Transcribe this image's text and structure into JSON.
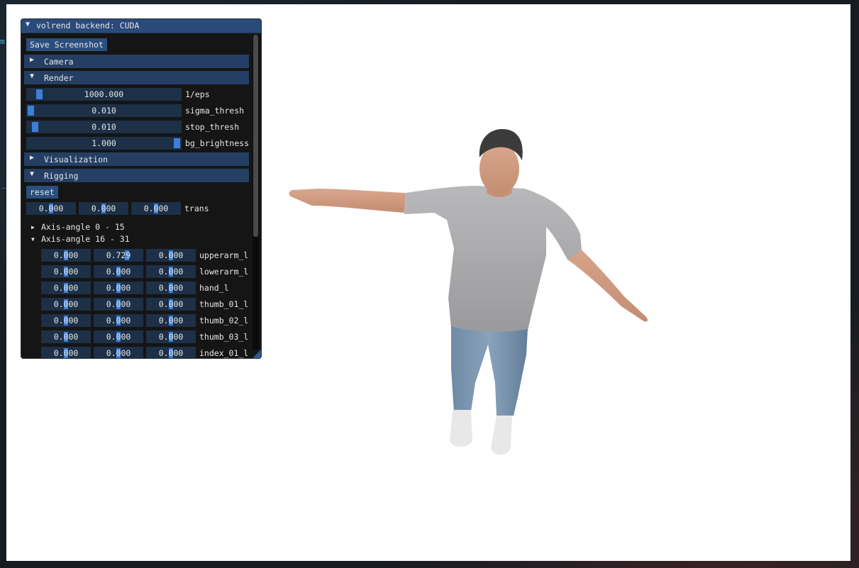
{
  "window": {
    "title": "volrend backend: CUDA",
    "save_screenshot": "Save Screenshot"
  },
  "sections": {
    "camera": "Camera",
    "render": "Render",
    "visualization": "Visualization",
    "rigging": "Rigging"
  },
  "render_params": [
    {
      "label": "1/eps",
      "value": "1000.000",
      "level": 0.06
    },
    {
      "label": "sigma_thresh",
      "value": "0.010",
      "level": 0.0
    },
    {
      "label": "stop_thresh",
      "value": "0.010",
      "level": 0.03
    },
    {
      "label": "bg_brightness",
      "value": "1.000",
      "level": 1.0
    }
  ],
  "rigging": {
    "reset": "reset",
    "trans": {
      "label": "trans",
      "values": [
        "0.000",
        "0.000",
        "0.000"
      ]
    },
    "group_collapsed": "Axis-angle 0 - 15",
    "group_expanded": "Axis-angle 16 - 31",
    "joints": [
      {
        "label": "upperarm_l",
        "values": [
          "0.000",
          "0.729",
          "0.000"
        ]
      },
      {
        "label": "lowerarm_l",
        "values": [
          "0.000",
          "0.000",
          "0.000"
        ]
      },
      {
        "label": "hand_l",
        "values": [
          "0.000",
          "0.000",
          "0.000"
        ]
      },
      {
        "label": "thumb_01_l",
        "values": [
          "0.000",
          "0.000",
          "0.000"
        ]
      },
      {
        "label": "thumb_02_l",
        "values": [
          "0.000",
          "0.000",
          "0.000"
        ]
      },
      {
        "label": "thumb_03_l",
        "values": [
          "0.000",
          "0.000",
          "0.000"
        ]
      },
      {
        "label": "index_01_l",
        "values": [
          "0.000",
          "0.000",
          "0.000"
        ]
      }
    ]
  },
  "colors": {
    "accent": "#3d7fd6",
    "header_bg": "#243f63",
    "title_bg": "#294a7a",
    "panel_bg": "#151515"
  }
}
